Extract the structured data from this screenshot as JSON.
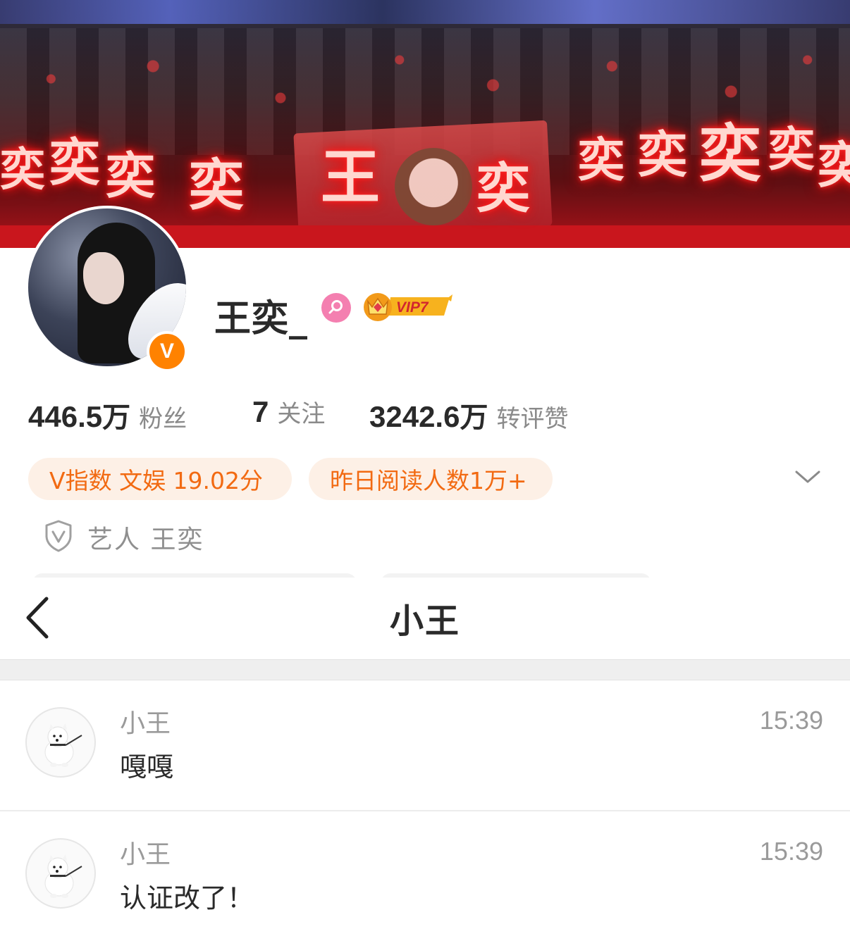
{
  "banner": {
    "neon_text": [
      "奕",
      "奕",
      "奕",
      "奕",
      "王",
      "奕",
      "奕",
      "奕",
      "奕",
      "奕",
      "奕"
    ]
  },
  "profile": {
    "username": "王奕_",
    "vip_label": "VIP7",
    "verified_badge": "V",
    "stats": [
      {
        "value": "446.5",
        "unit": "万",
        "label": "粉丝"
      },
      {
        "value": "7",
        "unit": "",
        "label": "关注"
      },
      {
        "value": "3242.6",
        "unit": "万",
        "label": "转评赞"
      }
    ],
    "pills": [
      "V指数 文娱 19.02分",
      "昨日阅读人数1万+"
    ],
    "certification": "艺人 王奕",
    "colors": {
      "accent": "#ff8200",
      "pill_text": "#f26a12",
      "pill_bg": "#fdf0e6",
      "gender": "#f47fb0"
    }
  },
  "chat": {
    "title": "小王",
    "messages": [
      {
        "sender": "小王",
        "text": "嘎嘎",
        "time": "15:39"
      },
      {
        "sender": "小王",
        "text": "认证改了！",
        "time": "15:39"
      }
    ]
  }
}
